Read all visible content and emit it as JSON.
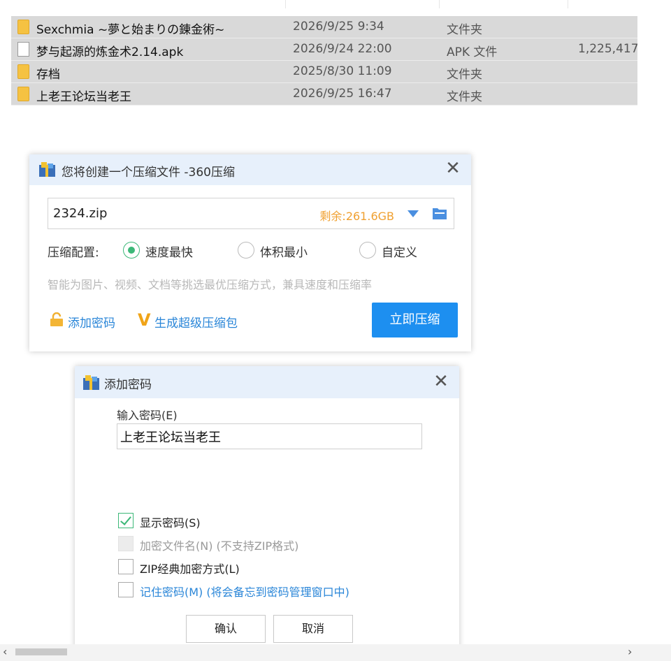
{
  "explorer": {
    "files": [
      {
        "icon": "folder-icon",
        "name": "Sexchmia ~夢と始まりの錬金術~",
        "date": "2026/9/25 9:34",
        "type": "文件夹",
        "size": ""
      },
      {
        "icon": "file-icon",
        "name": "梦与起源的炼金术2.14.apk",
        "date": "2026/9/24 22:00",
        "type": "APK 文件",
        "size": "1,225,417."
      },
      {
        "icon": "folder-icon",
        "name": "存档",
        "date": "2025/8/30 11:09",
        "type": "文件夹",
        "size": ""
      },
      {
        "icon": "folder-icon",
        "name": "上老王论坛当老王",
        "date": "2026/9/25 16:47",
        "type": "文件夹",
        "size": ""
      }
    ]
  },
  "compress_dialog": {
    "title": "您将创建一个压缩文件 -360压缩",
    "close_glyph": "✕",
    "filename": "2324.zip",
    "free_space": "剩余:261.6GB",
    "config_label": "压缩配置:",
    "options": [
      {
        "label": "速度最快",
        "selected": true
      },
      {
        "label": "体积最小",
        "selected": false
      },
      {
        "label": "自定义",
        "selected": false
      }
    ],
    "hint": "智能为图片、视频、文档等挑选最优压缩方式，兼具速度和压缩率",
    "add_password_link": "添加密码",
    "super_package_link": "生成超级压缩包",
    "compress_button": "立即压缩",
    "accent_color": "#1d8ff0"
  },
  "password_dialog": {
    "title": "添加密码",
    "close_glyph": "✕",
    "input_label": "输入密码(E)",
    "input_value": "上老王论坛当老王",
    "checkboxes": [
      {
        "label": "显示密码(S)",
        "checked": true,
        "disabled": false
      },
      {
        "label": "加密文件名(N) (不支持ZIP格式)",
        "checked": false,
        "disabled": true
      },
      {
        "label": "ZIP经典加密方式(L)",
        "checked": false,
        "disabled": false
      },
      {
        "label": "记住密码(M) (将会备忘到密码管理窗口中)",
        "checked": false,
        "disabled": false
      }
    ],
    "ok_button": "确认",
    "cancel_button": "取消"
  },
  "scrollbar": {
    "left_arrow": "‹",
    "right_arrow": "›"
  }
}
